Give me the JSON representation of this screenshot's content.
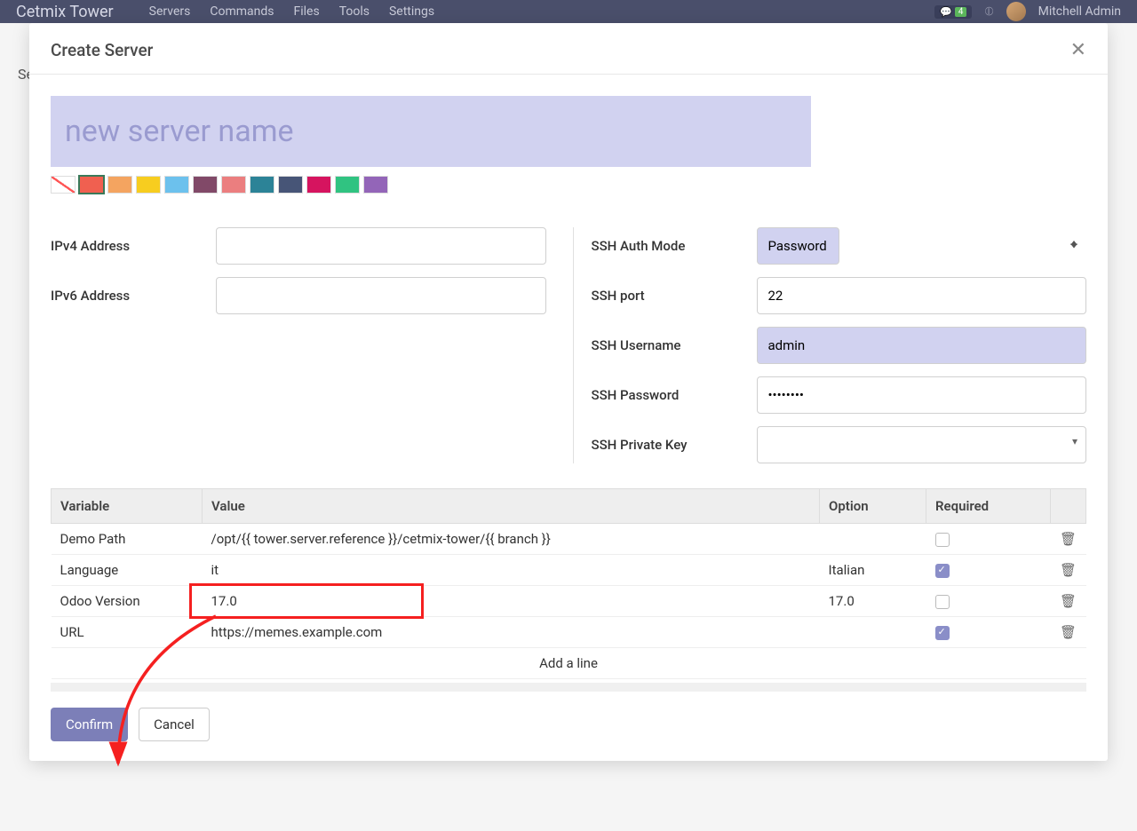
{
  "topbar": {
    "brand": "Cetmix Tower",
    "nav": [
      "Servers",
      "Commands",
      "Files",
      "Tools",
      "Settings"
    ],
    "msg_count": "4",
    "user": "Mitchell Admin"
  },
  "bg": {
    "search_label": "Se"
  },
  "modal": {
    "title": "Create Server",
    "name_placeholder": "new server name",
    "colors": [
      "#ffffff",
      "#f06050",
      "#f4a460",
      "#f7cd1f",
      "#6cc1ed",
      "#814968",
      "#eb7e7f",
      "#2c8397",
      "#475577",
      "#d6145f",
      "#30c381",
      "#9365b8"
    ],
    "left": {
      "ipv4_label": "IPv4 Address",
      "ipv4_value": "",
      "ipv6_label": "IPv6 Address",
      "ipv6_value": ""
    },
    "right": {
      "auth_label": "SSH Auth Mode",
      "auth_value": "Password",
      "port_label": "SSH port",
      "port_value": "22",
      "user_label": "SSH Username",
      "user_value": "admin",
      "pass_label": "SSH Password",
      "pass_value": "••••••••",
      "pkey_label": "SSH Private Key",
      "pkey_value": ""
    },
    "table": {
      "headers": {
        "variable": "Variable",
        "value": "Value",
        "option": "Option",
        "required": "Required"
      },
      "rows": [
        {
          "variable": "Demo Path",
          "value": "/opt/{{ tower.server.reference }}/cetmix-tower/{{ branch }}",
          "option": "",
          "required": false
        },
        {
          "variable": "Language",
          "value": "it",
          "option": "Italian",
          "required": true
        },
        {
          "variable": "Odoo Version",
          "value": "17.0",
          "option": "17.0",
          "required": false
        },
        {
          "variable": "URL",
          "value": "https://memes.example.com",
          "option": "",
          "required": true
        }
      ],
      "add_line": "Add a line"
    },
    "footer": {
      "confirm": "Confirm",
      "cancel": "Cancel"
    }
  }
}
